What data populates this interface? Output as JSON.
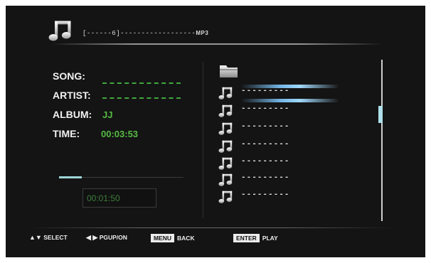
{
  "header": {
    "bar_text": "[------6]------------------",
    "format": "MP3",
    "icon": "music-note-icon"
  },
  "info": {
    "song_label": "SONG:",
    "song_value": "",
    "artist_label": "ARTIST:",
    "artist_value": "",
    "album_label": "ALBUM:",
    "album_value": "JJ",
    "time_label": "TIME:",
    "time_value": "00:03:53"
  },
  "playback": {
    "elapsed": "00:01:50",
    "progress_fraction": 0.18
  },
  "file_list": {
    "folder_icon": "folder-icon",
    "tracks": [
      {
        "name": "---------",
        "icon": "music-note-icon"
      },
      {
        "name": "---------",
        "icon": "music-note-icon"
      },
      {
        "name": "---------",
        "icon": "music-note-icon"
      },
      {
        "name": "---------",
        "icon": "music-note-icon"
      },
      {
        "name": "---------",
        "icon": "music-note-icon"
      },
      {
        "name": "---------",
        "icon": "music-note-icon"
      },
      {
        "name": "---------",
        "icon": "music-note-icon"
      }
    ]
  },
  "footer": {
    "select_label": "SELECT",
    "page_label": "PGUP/ON",
    "menu_key": "MENU",
    "back_label": "BACK",
    "enter_key": "ENTER",
    "play_label": "PLAY"
  },
  "colors": {
    "background": "#141414",
    "value_green": "#55bb44",
    "dash_green": "#3fa83f",
    "highlight_blue": "#78bef0",
    "progress": "#9fd6d6"
  }
}
